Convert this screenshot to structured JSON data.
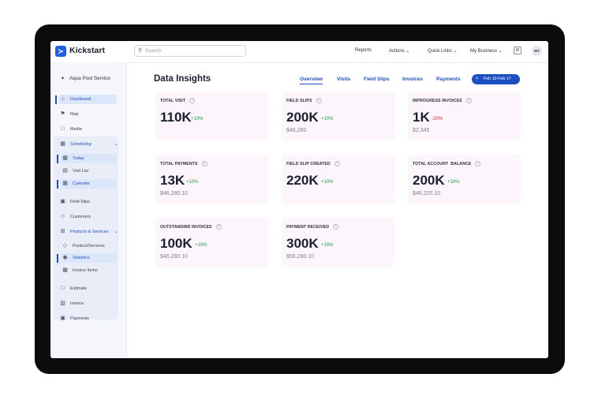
{
  "app": {
    "brand": "Kickstart",
    "logo_glyph": "≻"
  },
  "search": {
    "placeholder": "Search"
  },
  "topnav": {
    "items": [
      {
        "label": "Reports"
      },
      {
        "label": "Actions ⌄"
      },
      {
        "label": "Quick Links ⌄"
      },
      {
        "label": "My Business ⌄"
      }
    ],
    "avatar_initials": "WT"
  },
  "sidebar": {
    "business": "Aqua Pool Service",
    "items": [
      {
        "label": "Dashboard",
        "icon": "home-icon"
      },
      {
        "label": "Map",
        "icon": "map-icon"
      },
      {
        "label": "Media",
        "icon": "folder-icon"
      },
      {
        "label": "Scheduling",
        "icon": "calendar-icon"
      },
      {
        "label": "Today",
        "icon": "calendar-today-icon"
      },
      {
        "label": "Visit List",
        "icon": "list-icon"
      },
      {
        "label": "Calender",
        "icon": "calendar-grid-icon"
      },
      {
        "label": "Field Slips",
        "icon": "clipboard-icon"
      },
      {
        "label": "Customers",
        "icon": "users-icon"
      },
      {
        "label": "Products & Services",
        "icon": "grid-icon"
      },
      {
        "label": "Product/Services",
        "icon": "box-icon"
      },
      {
        "label": "Statistics",
        "icon": "stats-icon"
      },
      {
        "label": "Invoice Items",
        "icon": "invoice-items-icon"
      },
      {
        "label": "Estimate",
        "icon": "estimate-icon"
      },
      {
        "label": "Invoice",
        "icon": "invoice-icon"
      },
      {
        "label": "Payments",
        "icon": "payments-icon"
      }
    ]
  },
  "main": {
    "title": "Data Insights",
    "tabs": [
      {
        "label": "Overview"
      },
      {
        "label": "Visits"
      },
      {
        "label": "Field Slips"
      },
      {
        "label": "Invoices"
      },
      {
        "label": "Payments"
      }
    ],
    "date_range": "Feb 10-Feb 17",
    "cards": [
      {
        "label": "TOTAL VISIT",
        "value": "110K",
        "change": "+10%",
        "sub": ""
      },
      {
        "label": "FIELD SLIPS",
        "value": "200K",
        "change": "+10%",
        "sub": "$46,280"
      },
      {
        "label": "INPROGRESS INVOICES",
        "value": "1K",
        "change": "-20%",
        "sub": "$2,345"
      },
      {
        "label": "TOTAL PAYMENTS",
        "value": "13K",
        "change": "+10%",
        "sub": "$46,280.10"
      },
      {
        "label": "FIELD SLIP CREATED",
        "value": "220K",
        "change": "+10%",
        "sub": ""
      },
      {
        "label": "TOTAL ACCOUNT  BALANCE",
        "value": "200K",
        "change": "+10%",
        "sub": "$46,220.10"
      },
      {
        "label": "OUTSTANDIND INVOICES",
        "value": "100K",
        "change": "+10%",
        "sub": "$46,280.10"
      },
      {
        "label": "PAYMENT RECEIVED",
        "value": "300K",
        "change": "+15%",
        "sub": "$56,280.10"
      }
    ]
  },
  "colors": {
    "accent": "#1d4fc4",
    "positive": "#1a9c45",
    "negative": "#d92323",
    "card_bg": "#fdf5fc"
  }
}
